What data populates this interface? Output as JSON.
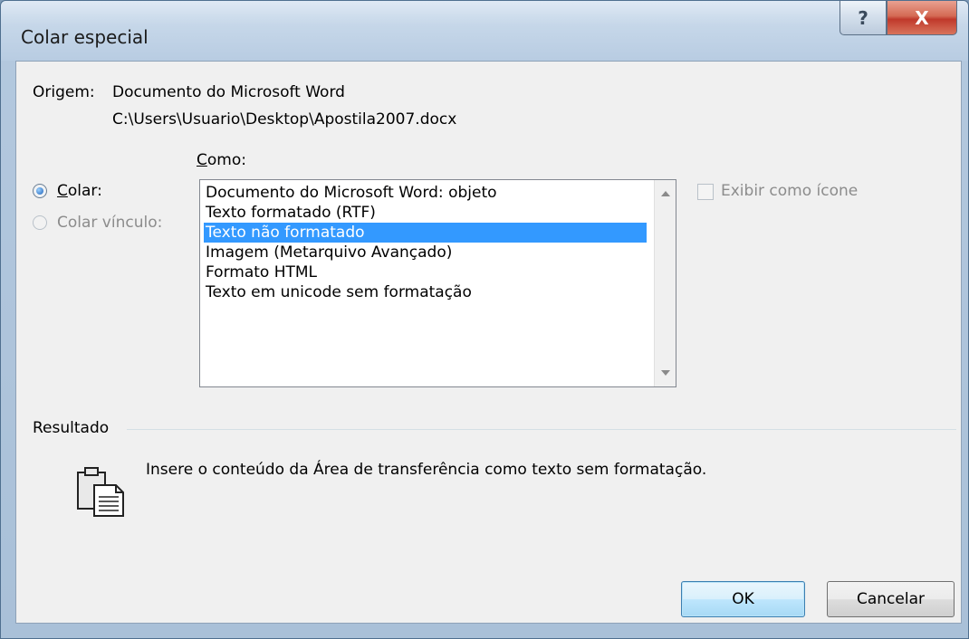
{
  "window": {
    "title": "Colar especial",
    "help_glyph": "?",
    "close_glyph": "X"
  },
  "source": {
    "label": "Origem:",
    "document_type": "Documento do Microsoft Word",
    "path": "C:\\Users\\Usuario\\Desktop\\Apostila2007.docx"
  },
  "paste_mode": {
    "como_label": "Como:",
    "colar_label": "Colar:",
    "colar_vinculo_label": "Colar vínculo:",
    "selected": "Colar"
  },
  "formats": {
    "items": [
      "Documento do Microsoft Word: objeto",
      "Texto formatado (RTF)",
      "Texto não formatado",
      "Imagem (Metarquivo Avançado)",
      "Formato HTML",
      "Texto em unicode sem formatação"
    ],
    "selected_index": 2
  },
  "display_as_icon": {
    "label": "Exibir como ícone",
    "checked": false,
    "enabled": false
  },
  "result": {
    "label": "Resultado",
    "description": "Insere o conteúdo da Área de transferência como texto sem formatação.",
    "icon": "clipboard-text-icon"
  },
  "buttons": {
    "ok": "OK",
    "cancel": "Cancelar"
  },
  "colors": {
    "selection": "#3399ff",
    "dialog_bg": "#f0f0f0",
    "close_button": "#c0392b"
  }
}
